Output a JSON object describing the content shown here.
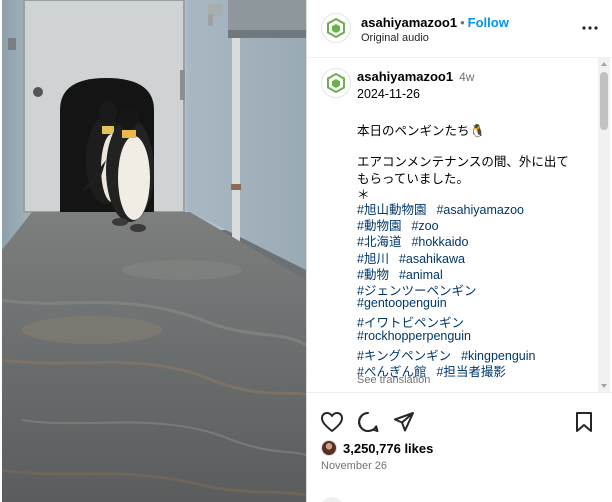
{
  "post": {
    "username": "asahiyamazoo1",
    "follow_label": "Follow",
    "dot": "•",
    "audio_label": "Original audio",
    "more_label": "More options"
  },
  "caption": {
    "username": "asahiyamazoo1",
    "age": "4w",
    "date": "2024-11-26",
    "title": "本日のペンギンたち🐧",
    "body_line1": "エアコンメンテナンスの間、外に出て",
    "body_line2": "もらっていました。",
    "separator": "＊",
    "tag_rows": [
      [
        "#旭山動物園",
        "#asahiyamazoo"
      ],
      [
        "#動物園",
        "#zoo"
      ],
      [
        "#北海道",
        "#hokkaido"
      ],
      [
        "#旭川",
        "#asahikawa"
      ],
      [
        "#動物",
        "#animal"
      ],
      [
        "#ジェンツーペンギン"
      ],
      [
        "#gentoopenguin"
      ],
      [
        "#イワトビペンギン"
      ],
      [
        "#rockhopperpenguin"
      ],
      [
        "#キングペンギン",
        "#kingpenguin"
      ],
      [
        "#ぺんぎん館",
        "#担当者撮影"
      ]
    ],
    "see_translation": "See translation"
  },
  "engagement": {
    "likes": "3,250,776 likes",
    "date": "November 26"
  },
  "icons": {
    "like": "heart-icon",
    "comment": "comment-icon",
    "share": "share-icon",
    "save": "bookmark-icon",
    "more": "more-icon",
    "avatar": "zoo-logo-icon"
  },
  "colors": {
    "accent": "#0095f6",
    "hashtag": "#00376b",
    "muted": "#737373",
    "logo_green": "#6ab04c"
  }
}
